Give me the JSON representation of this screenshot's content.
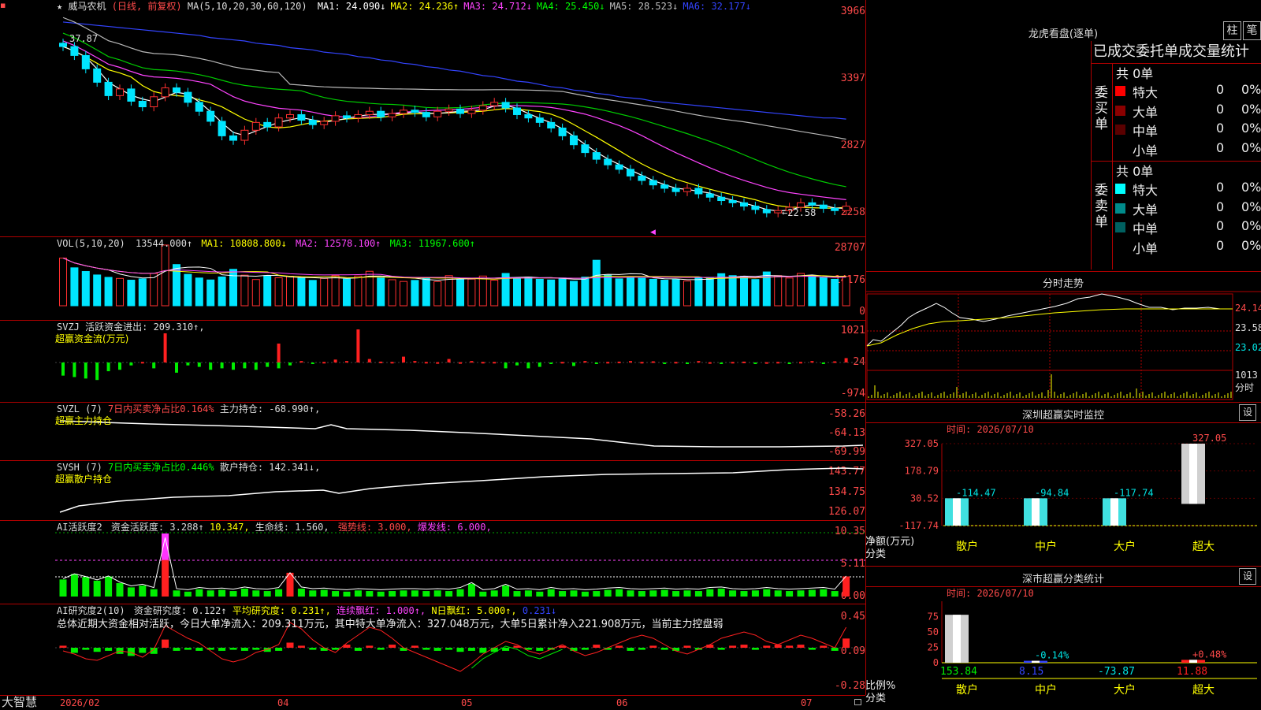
{
  "stock": {
    "name": "威马农机",
    "period": "(日线, 前复权)",
    "ma_label": "MA(5,10,20,30,60,120)",
    "pointer": "◀",
    "ma_values": [
      {
        "label": "MA1:",
        "value": "24.090↓",
        "color": "#ffffff"
      },
      {
        "label": "MA2:",
        "value": "24.236↑",
        "color": "#ffff00"
      },
      {
        "label": "MA3:",
        "value": "24.712↓",
        "color": "#ff44ff"
      },
      {
        "label": "MA4:",
        "value": "25.450↓",
        "color": "#00ff00"
      },
      {
        "label": "MA5:",
        "value": "28.523↓",
        "color": "#c0c0c0"
      },
      {
        "label": "MA6:",
        "value": "32.177↓",
        "color": "#3344ff"
      }
    ]
  },
  "app": {
    "brand": "大智慧"
  },
  "price_panel": {
    "yticks": [
      "3966",
      "3397",
      "2827",
      "2258"
    ],
    "high_mark": "37.87",
    "low_mark": "←22.58"
  },
  "vol_panel": {
    "title": "VOL(5,10,20)",
    "value": "13544.000↑",
    "ma1": "MA1: 10808.800↓",
    "ma2": "MA2: 12578.100↑",
    "ma3": "MA3: 11967.600↑",
    "yticks": [
      "28707",
      "14176",
      "0"
    ]
  },
  "svzj_panel": {
    "title": "SVZJ  活跃资金进出: 209.310↑,",
    "subtitle": "超赢资金流(万元)",
    "yticks": [
      "1021",
      "24",
      "-974"
    ]
  },
  "svzl_panel": {
    "title": "SVZL (7)",
    "ratio": "7日内买卖净占比0.164%",
    "hold": "主力持仓: -68.990↑,",
    "subtitle": "超赢主力持仓",
    "yticks": [
      "-58.26",
      "-64.13",
      "-69.99"
    ]
  },
  "svsh_panel": {
    "title": "SVSH (7)",
    "ratio": "7日内买卖净占比0.446%",
    "hold": "散户持仓: 142.341↓,",
    "subtitle": "超赢散户持仓",
    "yticks": [
      "143.77",
      "134.75",
      "126.07"
    ]
  },
  "ai1_panel": {
    "title": "AI活跃度2",
    "item1": "资金活跃度: 3.288↑",
    "item2": "10.347,",
    "item3": "生命线: 1.560,",
    "item4": "强势线: 3.000,",
    "item5": "爆发线: 6.000,",
    "yticks": [
      "10.35",
      "5.11",
      "0.00"
    ]
  },
  "ai2_panel": {
    "title": "AI研究度2(10)",
    "item1": "资金研究度: 0.122↑",
    "item2": "平均研究度: 0.231↑,",
    "item3": "连续飘红: 1.000↑,",
    "item4": "N日飘红: 5.000↑,",
    "item5": "0.231↓",
    "summary": "总体近期大资金相对活跃，今日大单净流入：209.311万元，其中特大单净流入：327.048万元，大单5日累计净入221.908万元，当前主力控盘弱",
    "yticks": [
      "0.45",
      "0.09",
      "-0.28"
    ]
  },
  "xaxis": {
    "labels": [
      "2026/02",
      "04",
      "05",
      "06",
      "07"
    ]
  },
  "dragon": {
    "title": "龙虎看盘(逐单)",
    "tab1": "柱",
    "tab2": "笔",
    "header": "已成交委托单成交量统计",
    "buy": {
      "side": "委买单",
      "total": "共 0单",
      "rows": [
        {
          "label": "特大",
          "count": "0",
          "pct": "0%",
          "color": "#ff0000"
        },
        {
          "label": "大单",
          "count": "0",
          "pct": "0%",
          "color": "#8b0000"
        },
        {
          "label": "中单",
          "count": "0",
          "pct": "0%",
          "color": "#5a0000"
        },
        {
          "label": "小单",
          "count": "0",
          "pct": "0%",
          "color": "#000000"
        }
      ]
    },
    "sell": {
      "side": "委卖单",
      "total": "共 0单",
      "rows": [
        {
          "label": "特大",
          "count": "0",
          "pct": "0%",
          "color": "#00ffff"
        },
        {
          "label": "大单",
          "count": "0",
          "pct": "0%",
          "color": "#008b8b"
        },
        {
          "label": "中单",
          "count": "0",
          "pct": "0%",
          "color": "#006060"
        },
        {
          "label": "小单",
          "count": "0",
          "pct": "0%",
          "color": "#000000"
        }
      ]
    }
  },
  "intraday": {
    "title": "分时走势",
    "price_ticks": [
      "24.14",
      "23.58",
      "23.02"
    ],
    "vol_tick": "1013",
    "vol_label": "分时"
  },
  "sz_monitor": {
    "title": "深圳超赢实时监控",
    "set": "设",
    "time": "时间: 2026/07/10",
    "yticks": [
      "327.05",
      "178.79",
      "30.52",
      "-117.74"
    ],
    "ylabel": "净额(万元)",
    "xlabel": "分类",
    "categories": [
      "散户",
      "中户",
      "大户",
      "超大"
    ],
    "values": [
      -114.47,
      -94.84,
      -117.74,
      327.05
    ],
    "value_labels": [
      "-114.47",
      "-94.84",
      "-117.74",
      "327.05"
    ]
  },
  "sz_class": {
    "title": "深市超赢分类统计",
    "set": "设",
    "time": "时间: 2026/07/10",
    "yticks": [
      "75",
      "50",
      "25",
      "0"
    ],
    "ylabel": "比例%",
    "xlabel": "分类",
    "categories": [
      "散户",
      "中户",
      "大户",
      "超大"
    ],
    "values": [
      153.84,
      8.15,
      -73.87,
      11.88
    ],
    "value_labels": [
      "153.84",
      "8.15",
      "-73.87",
      "11.88"
    ],
    "bar_labels": [
      "",
      "-0.14%",
      "",
      "+0.48%"
    ]
  },
  "chart_data": {
    "type": "line",
    "title": "威马农机 (日线, 前复权)",
    "x_start": "2026/02",
    "x_labels": [
      "2026/02",
      "04",
      "05",
      "06",
      "07"
    ],
    "close": [
      37.6,
      36.8,
      35.6,
      34.4,
      33.2,
      33.8,
      32.7,
      32.2,
      33.1,
      33.9,
      33.5,
      32.6,
      31.8,
      30.9,
      29.6,
      29.2,
      30.1,
      30.8,
      30.4,
      31.2,
      31.5,
      31.0,
      30.6,
      30.9,
      31.4,
      31.2,
      31.5,
      31.8,
      31.3,
      31.6,
      31.9,
      31.7,
      31.3,
      31.8,
      32.0,
      31.6,
      31.9,
      32.3,
      32.6,
      32.1,
      31.5,
      31.2,
      30.8,
      30.3,
      29.6,
      28.8,
      28.1,
      27.5,
      27.0,
      26.6,
      26.0,
      25.6,
      25.2,
      24.9,
      24.6,
      24.9,
      24.4,
      24.1,
      23.8,
      23.6,
      23.3,
      23.0,
      22.7,
      22.9,
      23.2,
      23.6,
      23.4,
      23.1,
      22.9,
      23.3
    ],
    "ma6": [
      39.8,
      39.7,
      39.6,
      39.5,
      39.4,
      39.3,
      39.2,
      39.1,
      39.0,
      38.9,
      38.8,
      38.7,
      38.6,
      38.4,
      38.3,
      38.2,
      38.1,
      37.9,
      37.8,
      37.7,
      37.5,
      37.4,
      37.3,
      37.1,
      37.0,
      36.9,
      36.7,
      36.6,
      36.4,
      36.3,
      36.1,
      36.0,
      35.8,
      35.7,
      35.5,
      35.4,
      35.2,
      35.0,
      34.9,
      34.7,
      34.5,
      34.4,
      34.2,
      34.0,
      33.9,
      33.7,
      33.6,
      33.4,
      33.3,
      33.1,
      33.0,
      32.9,
      32.7,
      32.6,
      32.5,
      32.4,
      32.3,
      32.2,
      32.1,
      32.0,
      31.9,
      31.8,
      31.7,
      31.6,
      31.5,
      31.4,
      31.3,
      31.2,
      31.2,
      31.1
    ],
    "volume": [
      22000,
      17500,
      15800,
      14200,
      13100,
      12600,
      11800,
      12400,
      14900,
      28000,
      19000,
      14500,
      12800,
      11900,
      13300,
      16800,
      14100,
      12100,
      13900,
      12900,
      13600,
      12700,
      11700,
      12600,
      13900,
      12300,
      13700,
      15900,
      12800,
      12000,
      11200,
      11700,
      12900,
      11100,
      13900,
      12100,
      12300,
      13700,
      11800,
      14900,
      12700,
      13200,
      12200,
      11900,
      12800,
      11300,
      13200,
      21000,
      14100,
      12400,
      13100,
      12700,
      12200,
      11800,
      12100,
      11400,
      12900,
      13100,
      14800,
      13900,
      13600,
      12100,
      15600,
      13900,
      12800,
      14900,
      13900,
      13100,
      12200,
      13544
    ],
    "ylim": [
      2258,
      3966
    ]
  }
}
